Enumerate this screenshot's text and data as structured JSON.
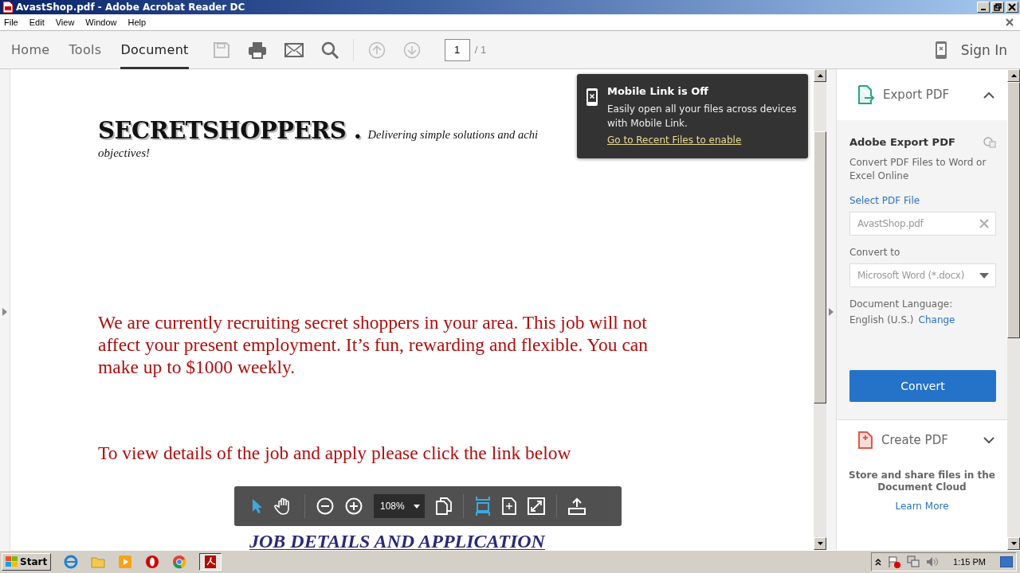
{
  "window": {
    "title": "AvastShop.pdf - Adobe Acrobat Reader DC"
  },
  "menu": [
    "File",
    "Edit",
    "View",
    "Window",
    "Help"
  ],
  "tabs": [
    {
      "label": "Home",
      "selected": false
    },
    {
      "label": "Tools",
      "selected": false
    },
    {
      "label": "Document",
      "selected": true
    }
  ],
  "page_nav": {
    "page": "1",
    "total": "/ 1"
  },
  "sign_in": "Sign In",
  "document": {
    "brand": "SECRETSHOPPERS .",
    "tagline": "Delivering simple solutions and achi",
    "tagline_cont": "objectives!",
    "paragraphs": [
      "We are currently recruiting secret shoppers in your area. This job will not affect your present employment. It’s fun, rewarding and flexible.  You can make up to $1000 weekly.",
      "To view details of the job and apply please click the link below"
    ],
    "link": "JOB DETAILS AND APPLICATION"
  },
  "popup": {
    "title": "Mobile Link is Off",
    "body": "Easily open all your files across devices with Mobile Link.",
    "link": "Go to Recent Files to enable"
  },
  "panel": {
    "export": {
      "title": "Export PDF",
      "expanded": true
    },
    "heading": "Adobe Export PDF",
    "description": "Convert PDF Files to Word or Excel Online",
    "select_label": "Select PDF File",
    "file": "AvastShop.pdf",
    "convert_label": "Convert to",
    "format": "Microsoft Word (*.docx)",
    "language_label": "Document Language:",
    "language": "English (U.S.)",
    "change": "Change",
    "convert_button": "Convert",
    "create": {
      "title": "Create PDF",
      "expanded": false
    },
    "cloud_text": "Store and share files in the Document Cloud",
    "learn_more": "Learn More"
  },
  "float_toolbar": {
    "zoom": "108%"
  },
  "taskbar": {
    "start": "Start",
    "clock": "1:15 PM"
  }
}
